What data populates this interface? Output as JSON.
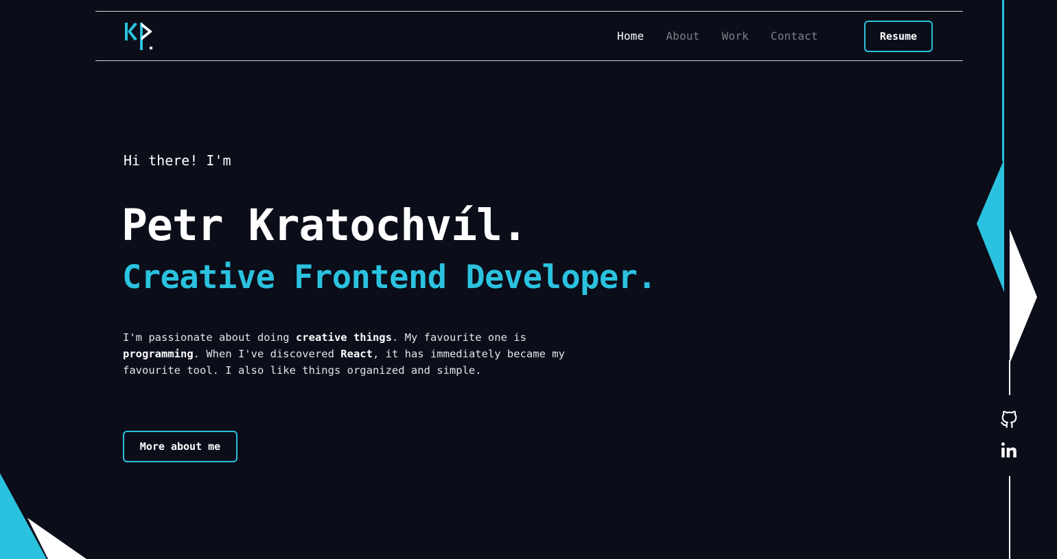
{
  "header": {
    "logo_alt": "KP.",
    "nav": [
      {
        "label": "Home",
        "active": true
      },
      {
        "label": "About",
        "active": false
      },
      {
        "label": "Work",
        "active": false
      },
      {
        "label": "Contact",
        "active": false
      }
    ],
    "resume_label": "Resume"
  },
  "hero": {
    "greeting": "Hi there! I'm",
    "name": "Petr Kratochvíl.",
    "role": "Creative Frontend Developer.",
    "bio": {
      "p1": "I'm passionate about doing ",
      "b1": "creative things",
      "p2": ". My favourite one is ",
      "b2": "programming",
      "p3": ". When I've discovered ",
      "b3": "React",
      "p4": ", it has immediately became my favourite tool. I also like things organized and simple."
    },
    "cta_label": "More about me"
  },
  "social": {
    "github_icon": "github-icon",
    "linkedin_icon": "linkedin-icon"
  },
  "colors": {
    "background": "#0b0d19",
    "accent": "#2bc2df",
    "text": "#ffffff",
    "muted": "#7d7f87"
  }
}
